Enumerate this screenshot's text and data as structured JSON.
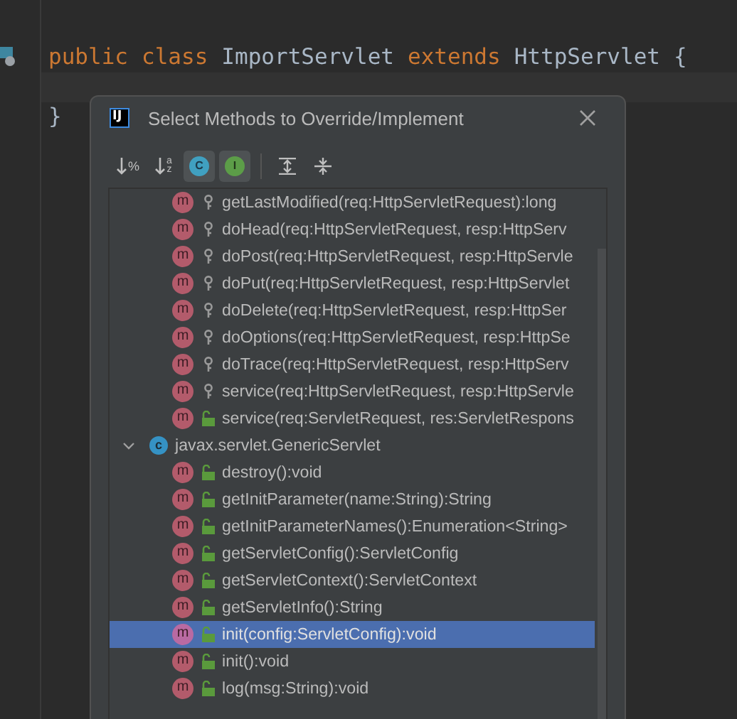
{
  "editor": {
    "lines": [
      {
        "tokens": [
          {
            "text": "public",
            "kind": "keyword"
          },
          {
            "text": "class",
            "kind": "keyword"
          },
          {
            "text": "ImportServlet",
            "kind": "plain"
          },
          {
            "text": "extends",
            "kind": "keyword"
          },
          {
            "text": "HttpServlet",
            "kind": "plain"
          },
          {
            "text": "{",
            "kind": "plain"
          }
        ]
      },
      {
        "current": true
      },
      {
        "tokens": [
          {
            "text": "}",
            "kind": "plain"
          }
        ]
      }
    ]
  },
  "dialog": {
    "logo": "IJ",
    "title": "Select Methods to Override/Implement",
    "toolbar": [
      {
        "kind": "sort-visibility",
        "label": "%",
        "selected": false
      },
      {
        "kind": "sort-alpha",
        "label": "az",
        "selected": false
      },
      {
        "kind": "classes",
        "label": "C",
        "selected": true
      },
      {
        "kind": "inherited",
        "label": "I",
        "selected": true
      },
      {
        "kind": "expand-all",
        "selected": false
      },
      {
        "kind": "collapse-all",
        "selected": false
      }
    ],
    "groups": [
      {
        "children": [
          {
            "badge": "m",
            "kind": "protected",
            "signature": "getLastModified(req:HttpServletRequest):long",
            "selected": false
          },
          {
            "badge": "m",
            "kind": "protected",
            "signature": "doHead(req:HttpServletRequest, resp:HttpServ",
            "selected": false
          },
          {
            "badge": "m",
            "kind": "protected",
            "signature": "doPost(req:HttpServletRequest, resp:HttpServle",
            "selected": false
          },
          {
            "badge": "m",
            "kind": "protected",
            "signature": "doPut(req:HttpServletRequest, resp:HttpServlet",
            "selected": false
          },
          {
            "badge": "m",
            "kind": "protected",
            "signature": "doDelete(req:HttpServletRequest, resp:HttpSer",
            "selected": false
          },
          {
            "badge": "m",
            "kind": "protected",
            "signature": "doOptions(req:HttpServletRequest, resp:HttpSe",
            "selected": false
          },
          {
            "badge": "m",
            "kind": "protected",
            "signature": "doTrace(req:HttpServletRequest, resp:HttpServ",
            "selected": false
          },
          {
            "badge": "m",
            "kind": "protected",
            "signature": "service(req:HttpServletRequest, resp:HttpServle",
            "selected": false
          },
          {
            "badge": "m",
            "kind": "public",
            "signature": "service(req:ServletRequest, res:ServletRespons",
            "selected": false
          }
        ]
      },
      {
        "badge": "c",
        "label": "javax.servlet.GenericServlet",
        "expanded": true,
        "children": [
          {
            "badge": "m",
            "kind": "public",
            "signature": "destroy():void",
            "selected": false
          },
          {
            "badge": "m",
            "kind": "public",
            "signature": "getInitParameter(name:String):String",
            "selected": false
          },
          {
            "badge": "m",
            "kind": "public",
            "signature": "getInitParameterNames():Enumeration<String>",
            "selected": false
          },
          {
            "badge": "m",
            "kind": "public",
            "signature": "getServletConfig():ServletConfig",
            "selected": false
          },
          {
            "badge": "m",
            "kind": "public",
            "signature": "getServletContext():ServletContext",
            "selected": false
          },
          {
            "badge": "m",
            "kind": "public",
            "signature": "getServletInfo():String",
            "selected": false
          },
          {
            "badge": "m",
            "kind": "public",
            "signature": "init(config:ServletConfig):void",
            "selected": true
          },
          {
            "badge": "m",
            "kind": "public",
            "signature": "init():void",
            "selected": false
          },
          {
            "badge": "m",
            "kind": "public",
            "signature": "log(msg:String):void",
            "selected": false
          }
        ]
      }
    ]
  }
}
